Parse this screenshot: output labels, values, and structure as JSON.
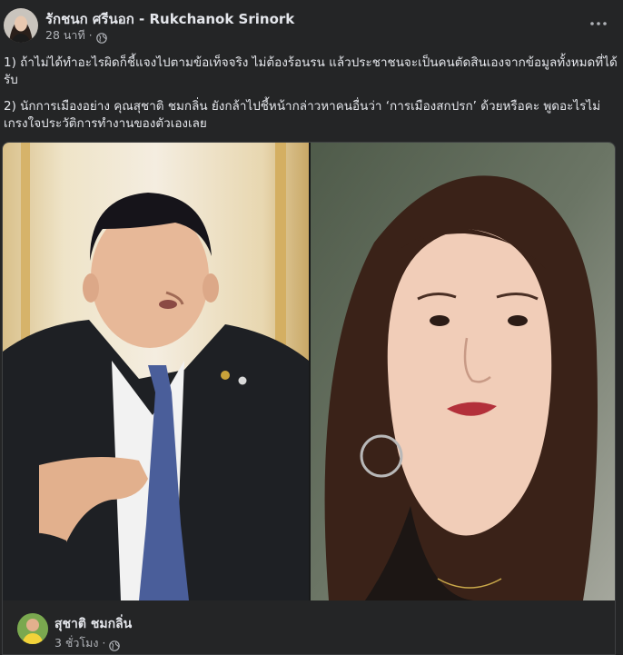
{
  "post": {
    "author": "รักชนก ศรีนอก - Rukchanok Srinork",
    "timestamp": "28 นาที",
    "separator": "·",
    "privacy_icon": "globe-icon",
    "more_icon": "more-horizontal-icon",
    "paragraphs": [
      "1) ถ้าไม่ได้ทำอะไรผิดก็ชี้แจงไปตามข้อเท็จจริง ไม่ต้องร้อนรน แล้วประชาชนจะเป็นคนตัดสินเองจากข้อมูลทั้งหมดที่ได้รับ",
      "2) นักการเมืองอย่าง คุณสุชาติ ชมกลิ่น ยังกล้าไปชี้หน้ากล่าวหาคนอื่นว่า ‘การเมืองสกปรก’ ด้วยหรือคะ พูดอะไรไม่เกรงใจประวัติการทำงานของตัวเองเลย"
    ]
  },
  "shared": {
    "author": "สุชาติ ชมกลิ่น",
    "timestamp": "3 ชั่วโมง",
    "separator": "·",
    "privacy_icon": "globe-icon"
  },
  "colors": {
    "background": "#242526",
    "text_primary": "#e4e6eb",
    "text_secondary": "#b0b3b8",
    "border": "#3e4042"
  }
}
